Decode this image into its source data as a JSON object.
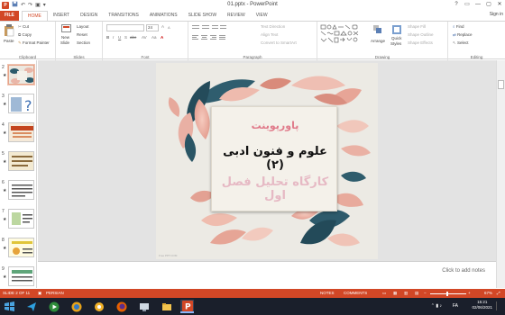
{
  "window": {
    "title": "01.pptx - PowerPoint",
    "app_badge": "P",
    "qat": [
      "↶",
      "↷",
      "▣",
      "▾"
    ],
    "controls": [
      "?",
      "▭",
      "—",
      "▢",
      "✕"
    ]
  },
  "tabs": [
    {
      "label": "FILE"
    },
    {
      "label": "HOME"
    },
    {
      "label": "INSERT"
    },
    {
      "label": "DESIGN"
    },
    {
      "label": "TRANSITIONS"
    },
    {
      "label": "ANIMATIONS"
    },
    {
      "label": "SLIDE SHOW"
    },
    {
      "label": "REVIEW"
    },
    {
      "label": "VIEW"
    }
  ],
  "signin": "Sign in",
  "ribbon": {
    "clipboard": {
      "paste": "Paste",
      "cut": "Cut",
      "copy": "Copy",
      "format_painter": "Format Painter",
      "label": "Clipboard"
    },
    "slides": {
      "new_slide_line1": "New",
      "new_slide_line2": "Slide",
      "layout": "Layout",
      "reset": "Reset",
      "section": "Section",
      "label": "Slides"
    },
    "font": {
      "font_name": "",
      "font_size": "24",
      "bold": "B",
      "italic": "I",
      "underline": "U",
      "strike": "S",
      "shadow": "abc",
      "spacing": "AV",
      "case": "Aa",
      "color": "A",
      "grow": "A",
      "shrink": "A",
      "label": "Font"
    },
    "paragraph": {
      "text_direction": "Text Direction",
      "align_text": "Align Text",
      "smartart": "Convert to SmartArt",
      "label": "Paragraph"
    },
    "drawing": {
      "arrange": "Arrange",
      "quick_styles_line1": "Quick",
      "quick_styles_line2": "Styles",
      "shape_fill": "Shape Fill",
      "shape_outline": "Shape Outline",
      "shape_effects": "Shape Effects",
      "label": "Drawing"
    },
    "editing": {
      "find": "Find",
      "replace": "Replace",
      "select": "Select",
      "label": "Editing"
    }
  },
  "thumbnails": [
    {
      "num": "2",
      "star": "★"
    },
    {
      "num": "3",
      "star": "★"
    },
    {
      "num": "4",
      "star": "★"
    },
    {
      "num": "5",
      "star": "★"
    },
    {
      "num": "6",
      "star": "★"
    },
    {
      "num": "7",
      "star": "★"
    },
    {
      "num": "8",
      "star": "★"
    },
    {
      "num": "9",
      "star": "★"
    }
  ],
  "slide": {
    "line1": "پاورپوینت",
    "line2": "علوم و فنون ادبی (۲)",
    "line3": "کارگاه تحلیل فصل اول",
    "watermark": "Free PPT.COM",
    "colors": {
      "line1": "#e07a8a",
      "line2": "#111111",
      "line3": "#e6b9c4"
    }
  },
  "notes_placeholder": "Click to add notes",
  "statusbar": {
    "slide_info": "SLIDE 2 OF 11",
    "language": "PERSIAN",
    "notes": "NOTES",
    "comments": "COMMENTS",
    "zoom": "67%"
  },
  "taskbar": {
    "time": "15:21",
    "date": "02/06/2021",
    "lang": "FA"
  },
  "colors": {
    "accent": "#d24726",
    "taskbar": "#1a1f2b"
  }
}
